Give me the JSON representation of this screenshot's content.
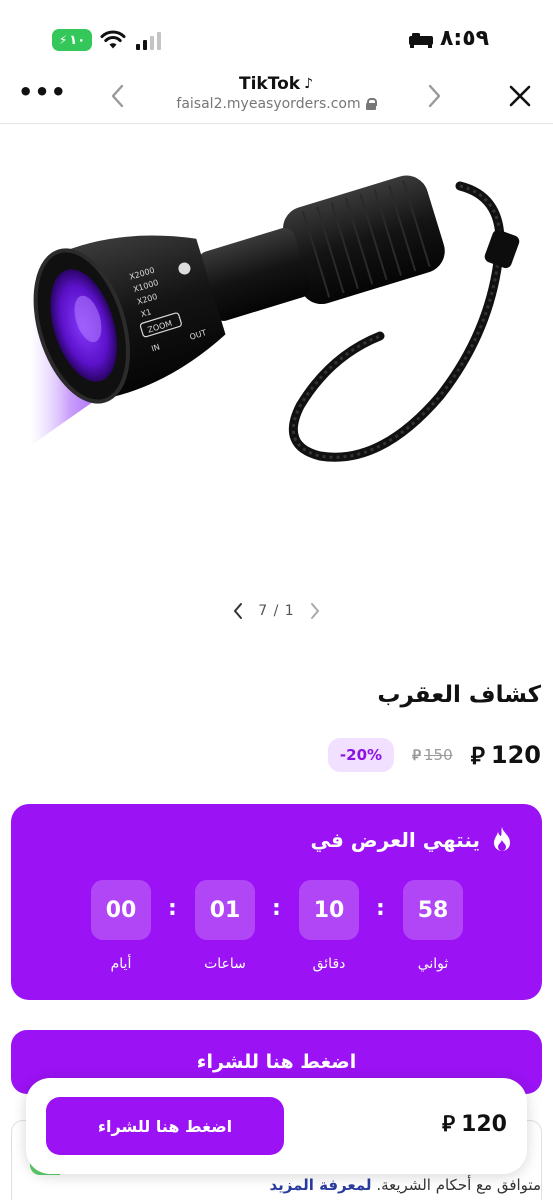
{
  "status_bar": {
    "time": "٨:٥٩",
    "battery": "١٠",
    "icons": [
      "battery-charging-icon",
      "wifi-icon",
      "signal-icon",
      "car-icon"
    ]
  },
  "browser": {
    "title": "TikTok",
    "url": "faisal2.myeasyorders.com",
    "icons": [
      "more-icon",
      "back-icon",
      "forward-icon",
      "close-icon",
      "lock-icon",
      "tiktok-icon"
    ]
  },
  "product": {
    "carousel_counter": "7 / 1",
    "title": "كشاف العقرب",
    "price": "120",
    "old_price": "150",
    "discount": "-20%",
    "currency_symbol": "⃁"
  },
  "countdown": {
    "title": "ينتهي العرض في",
    "units": [
      {
        "value": "58",
        "label": "ثواني"
      },
      {
        "value": "10",
        "label": "دقائق"
      },
      {
        "value": "01",
        "label": "ساعات"
      },
      {
        "value": "00",
        "label": "أيام"
      }
    ],
    "separator": ":"
  },
  "buy_button_label": "اضغط هنا للشراء",
  "terms": {
    "text": "متوافق مع أحكام الشريعة.",
    "link": "لمعرفة المزيد"
  },
  "float_bar": {
    "price": "120",
    "button_label": "اضغط هنا للشراء"
  },
  "colors": {
    "accent": "#9b12f5",
    "badge_bg": "#f1e0ff",
    "badge_text": "#8d12e6",
    "battery": "#34c759",
    "link": "#2a3c9e"
  }
}
